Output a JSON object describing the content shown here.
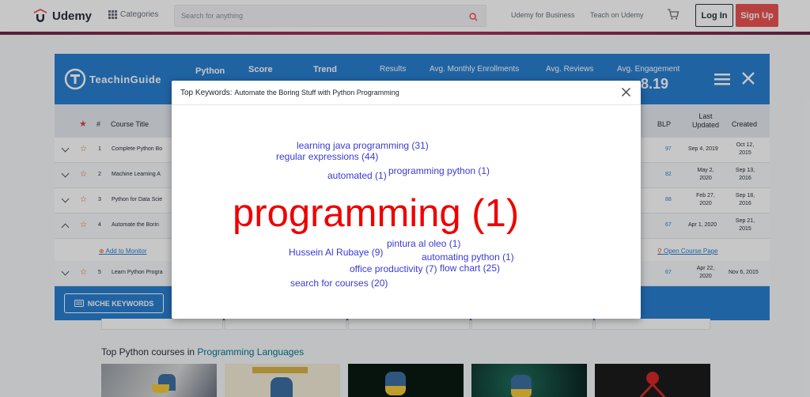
{
  "header": {
    "brand": "Udemy",
    "categories_label": "Categories",
    "search_placeholder": "Search for anything",
    "udemy_for_business": "Udemy for Business",
    "teach_on_udemy": "Teach on Udemy",
    "login_label": "Log In",
    "signup_label": "Sign Up"
  },
  "teachingguide": {
    "brand": "TeachinGuide",
    "stats": [
      {
        "label": "Python"
      },
      {
        "label": "Score"
      },
      {
        "label": "Trend"
      },
      {
        "label": "Results"
      },
      {
        "label": "Avg. Monthly Enrollments"
      },
      {
        "label": "Avg. Reviews"
      },
      {
        "label": "Avg. Engagement",
        "value": "8.19"
      }
    ],
    "columns": {
      "num": "#",
      "title": "Course Title",
      "blp": "BLP",
      "last_updated": "Last Updated",
      "created": "Created"
    },
    "rows": [
      {
        "num": "1",
        "title": "Complete Python Bo",
        "blp": "97",
        "updated": "Sep 4, 2019",
        "created": "Oct 12, 2015"
      },
      {
        "num": "2",
        "title": "Machine Learning A",
        "blp": "82",
        "updated": "May 2, 2020",
        "created": "Sep 13, 2016"
      },
      {
        "num": "3",
        "title": "Python for Data Scie",
        "blp": "88",
        "updated": "Feb 27, 2020",
        "created": "Sep 18, 2016"
      },
      {
        "num": "4",
        "title": "Automate the Borin",
        "blp": "67",
        "updated": "Apr 1, 2020",
        "created": "Sep 21, 2015"
      },
      {
        "num": "5",
        "title": "Learn Python Progra",
        "blp": "67",
        "updated": "Apr 22, 2020",
        "created": "Nov 6, 2015"
      }
    ],
    "add_to_monitor": "Add to Monitor",
    "open_course_page": "Open Course Page",
    "niche_keywords": "NICHE KEYWORDS"
  },
  "section": {
    "prefix": "Top Python courses in ",
    "link": "Programming Languages"
  },
  "modal": {
    "title_prefix": "Top Keywords:",
    "title_course": "Automate the Boring Stuff with Python Programming",
    "keywords": [
      "learning java programming (31)",
      "regular expressions (44)",
      "automated (1)",
      "programming python (1)",
      "programming (1)",
      "pintura al oleo (1)",
      "Hussein Al Rubaye (9)",
      "automating python (1)",
      "office productivity (7)",
      "flow chart (25)",
      "search for courses (20)"
    ]
  },
  "colors": {
    "udemy_red": "#ec5252",
    "teachingguide_blue": "#2a7fd1",
    "keyword_blue": "#3a3ad4",
    "keyword_highlight": "#ee0000"
  }
}
